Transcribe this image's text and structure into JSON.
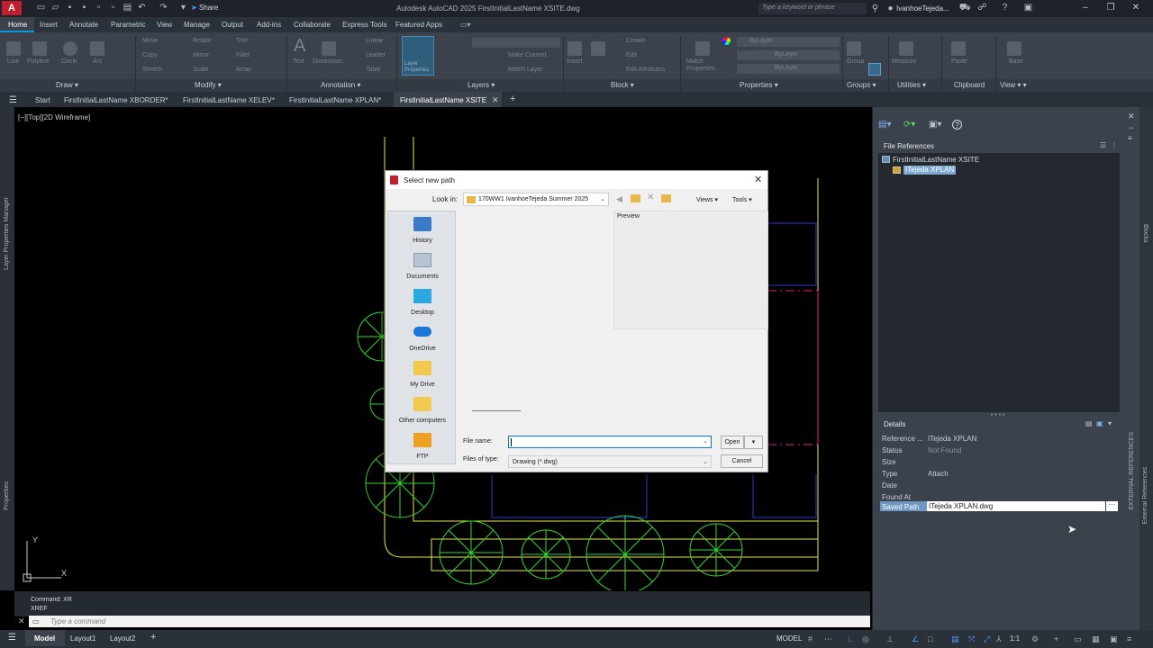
{
  "window": {
    "title": "Autodesk AutoCAD 2025    FirstInitialLastName XSITE.dwg",
    "search_placeholder": "Type a keyword or phrase",
    "user": "IvanhoeTejeda...",
    "share_label": "Share",
    "app_logo": "A"
  },
  "ribbon": {
    "tabs": [
      "Home",
      "Insert",
      "Annotate",
      "Parametric",
      "View",
      "Manage",
      "Output",
      "Add-ins",
      "Collaborate",
      "Express Tools",
      "Featured Apps"
    ],
    "draw_tools": [
      "Line",
      "Polyline",
      "Circle",
      "Arc"
    ],
    "modify_tools": [
      "Move",
      "Rotate",
      "Trim",
      "Copy",
      "Mirror",
      "Fillet",
      "Stretch",
      "Scale",
      "Array"
    ],
    "annotation_tools": [
      "Text",
      "Dimension",
      "Linear",
      "Leader",
      "Table"
    ],
    "layer_tools": [
      "Layer Properties",
      "Make Current",
      "Match Layer"
    ],
    "block_tools": [
      "Insert",
      "Create",
      "Edit",
      "Edit Attributes"
    ],
    "properties_tools": [
      "Match Properties",
      "ByLayer",
      "ByLayer",
      "ByLayer"
    ],
    "groups_label": "Group",
    "utilities_label": "Measure",
    "clipboard_label": "Paste",
    "view_label": "Base",
    "panels": [
      "Draw",
      "Modify",
      "Annotation",
      "Layers",
      "Block",
      "Properties",
      "Groups",
      "Utilities",
      "Clipboard",
      "View"
    ]
  },
  "doc_tabs": {
    "start": "Start",
    "tabs": [
      "FirstInitialLastName XBORDER*",
      "FirstInitialLastName XELEV*",
      "FirstInitialLastName XPLAN*",
      "FirstInitialLastName XSITE"
    ],
    "active_index": 3
  },
  "viewport": {
    "label": "[−][Top][2D Wireframe]",
    "left_tabs": [
      "Layer Properties Manager",
      "Properties"
    ]
  },
  "command": {
    "history": [
      "Command: XR",
      "XREF"
    ],
    "placeholder": "Type a command"
  },
  "status": {
    "tabs": [
      "Model",
      "Layout1",
      "Layout2"
    ],
    "model_label": "MODEL",
    "scale": "1:1"
  },
  "xref_palette": {
    "file_references_title": "File References",
    "tree": [
      "FirstInitialLastName XSITE",
      "ITejeda XPLAN"
    ],
    "details_title": "Details",
    "details": [
      {
        "key": "Reference ...",
        "value": "ITejeda XPLAN"
      },
      {
        "key": "Status",
        "value": "Not Found"
      },
      {
        "key": "Size",
        "value": ""
      },
      {
        "key": "Type",
        "value": "Attach"
      },
      {
        "key": "Date",
        "value": ""
      },
      {
        "key": "Found At",
        "value": ""
      },
      {
        "key": "Saved Path",
        "value": "ITejeda XPLAN.dwg"
      }
    ],
    "side_tabs": [
      "Blocks",
      "External References",
      "EXTERNAL REFERENCES"
    ]
  },
  "dialog": {
    "title": "Select new path",
    "look_in_label": "Look in:",
    "look_in_value": "170WW1 IvanhoeTejeda Summer 2025",
    "views_label": "Views",
    "tools_label": "Tools",
    "preview_label": "Preview",
    "places": [
      "History",
      "Documents",
      "Desktop",
      "OneDrive",
      "My Drive",
      "Other computers",
      "FTP"
    ],
    "file_name_label": "File name:",
    "file_name_value": "",
    "files_of_type_label": "Files of type:",
    "files_of_type_value": "Drawing (*.dwg)",
    "open_label": "Open",
    "cancel_label": "Cancel"
  },
  "colors": {
    "accent": "#0696d7",
    "drawing_green": "#33d633",
    "drawing_yellow": "#e8e84a",
    "drawing_blue": "#2a3bd6",
    "drawing_magenta": "#e01c8c",
    "autodesk_red": "#c01f2f"
  }
}
